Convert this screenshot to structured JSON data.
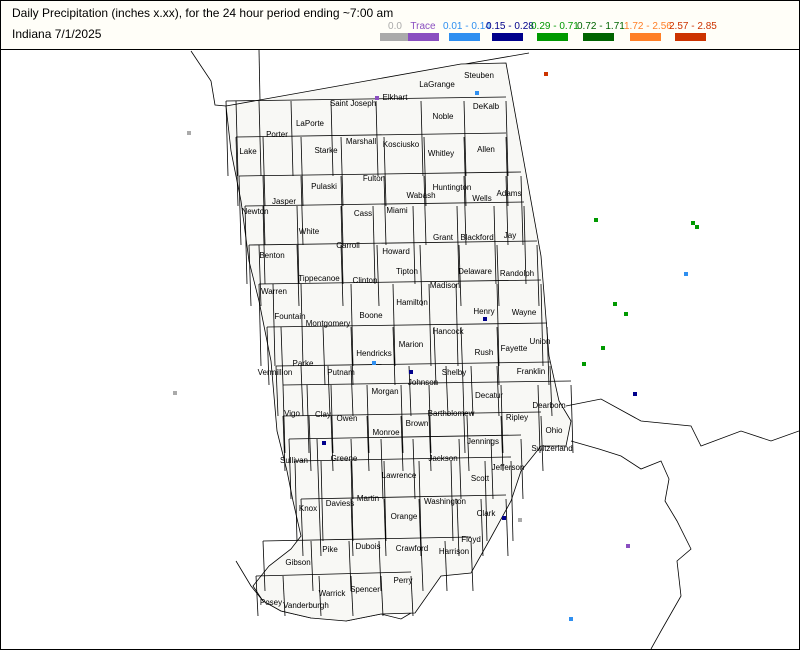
{
  "header": {
    "title": "Daily Precipitation (inches  x.xx),  for the 24 hour period ending ~7:00 am",
    "subtitle": "Indiana 7/1/2025"
  },
  "legend": [
    {
      "label": "0.0",
      "color": "#aaaaaa"
    },
    {
      "label": "Trace",
      "color": "#8a4fc0"
    },
    {
      "label": "0.01 - 0.14",
      "color": "#2f8ff0"
    },
    {
      "label": "0.15 - 0.28",
      "color": "#00008b"
    },
    {
      "label": "0.29 - 0.71",
      "color": "#009900"
    },
    {
      "label": "0.72 - 1.71",
      "color": "#006400"
    },
    {
      "label": "1.72 - 2.56",
      "color": "#ff7f27"
    },
    {
      "label": "2.57 - 2.85",
      "color": "#cc3300"
    }
  ],
  "counties": [
    {
      "name": "Lake"
    },
    {
      "name": "Porter"
    },
    {
      "name": "LaPorte"
    },
    {
      "name": "Saint Joseph"
    },
    {
      "name": "Elkhart"
    },
    {
      "name": "LaGrange"
    },
    {
      "name": "Steuben"
    },
    {
      "name": "DeKalb"
    },
    {
      "name": "Noble"
    },
    {
      "name": "Kosciusko"
    },
    {
      "name": "Marshall"
    },
    {
      "name": "Starke"
    },
    {
      "name": "Whitley"
    },
    {
      "name": "Allen"
    },
    {
      "name": "Newton"
    },
    {
      "name": "Jasper"
    },
    {
      "name": "Pulaski"
    },
    {
      "name": "Fulton"
    },
    {
      "name": "Huntington"
    },
    {
      "name": "Wabash"
    },
    {
      "name": "Miami"
    },
    {
      "name": "Cass"
    },
    {
      "name": "Wells"
    },
    {
      "name": "Adams"
    },
    {
      "name": "White"
    },
    {
      "name": "Carroll"
    },
    {
      "name": "Howard"
    },
    {
      "name": "Grant"
    },
    {
      "name": "Blackford"
    },
    {
      "name": "Jay"
    },
    {
      "name": "Benton"
    },
    {
      "name": "Tippecanoe"
    },
    {
      "name": "Clinton"
    },
    {
      "name": "Tipton"
    },
    {
      "name": "Delaware"
    },
    {
      "name": "Randolph"
    },
    {
      "name": "Warren"
    },
    {
      "name": "Madison"
    },
    {
      "name": "Fountain"
    },
    {
      "name": "Montgomery"
    },
    {
      "name": "Boone"
    },
    {
      "name": "Hamilton"
    },
    {
      "name": "Henry"
    },
    {
      "name": "Wayne"
    },
    {
      "name": "Hancock"
    },
    {
      "name": "Marion"
    },
    {
      "name": "Union"
    },
    {
      "name": "Fayette"
    },
    {
      "name": "Rush"
    },
    {
      "name": "Hendricks"
    },
    {
      "name": "Parke"
    },
    {
      "name": "Vermillion"
    },
    {
      "name": "Putnam"
    },
    {
      "name": "Johnson"
    },
    {
      "name": "Shelby"
    },
    {
      "name": "Franklin"
    },
    {
      "name": "Morgan"
    },
    {
      "name": "Decatur"
    },
    {
      "name": "Vigo"
    },
    {
      "name": "Clay"
    },
    {
      "name": "Owen"
    },
    {
      "name": "Bartholomew"
    },
    {
      "name": "Dearborn"
    },
    {
      "name": "Ripley"
    },
    {
      "name": "Ohio"
    },
    {
      "name": "Brown"
    },
    {
      "name": "Monroe"
    },
    {
      "name": "Jennings"
    },
    {
      "name": "Switzerland"
    },
    {
      "name": "Sullivan"
    },
    {
      "name": "Greene"
    },
    {
      "name": "Jackson"
    },
    {
      "name": "Jefferson"
    },
    {
      "name": "Lawrence"
    },
    {
      "name": "Scott"
    },
    {
      "name": "Knox"
    },
    {
      "name": "Daviess"
    },
    {
      "name": "Martin"
    },
    {
      "name": "Washington"
    },
    {
      "name": "Orange"
    },
    {
      "name": "Clark"
    },
    {
      "name": "Floyd"
    },
    {
      "name": "Pike"
    },
    {
      "name": "Dubois"
    },
    {
      "name": "Crawford"
    },
    {
      "name": "Harrison"
    },
    {
      "name": "Gibson"
    },
    {
      "name": "Perry"
    },
    {
      "name": "Warrick"
    },
    {
      "name": "Spencer"
    },
    {
      "name": "Posey"
    },
    {
      "name": "Vanderburgh"
    }
  ],
  "stations": [
    {
      "category": "Trace"
    },
    {
      "category": "0.01 - 0.14"
    },
    {
      "category": "2.57 - 2.85"
    },
    {
      "category": "0.0"
    },
    {
      "category": "0.29 - 0.71"
    },
    {
      "category": "0.29 - 0.71"
    },
    {
      "category": "0.29 - 0.71"
    },
    {
      "category": "0.01 - 0.14"
    },
    {
      "category": "0.29 - 0.71"
    },
    {
      "category": "0.29 - 0.71"
    },
    {
      "category": "0.15 - 0.28"
    },
    {
      "category": "0.29 - 0.71"
    },
    {
      "category": "0.29 - 0.71"
    },
    {
      "category": "0.01 - 0.14"
    },
    {
      "category": "0.15 - 0.28"
    },
    {
      "category": "0.0"
    },
    {
      "category": "0.15 - 0.28"
    },
    {
      "category": "0.15 - 0.28"
    },
    {
      "category": "0.15 - 0.28"
    },
    {
      "category": "0.0"
    },
    {
      "category": "Trace"
    },
    {
      "category": "0.01 - 0.14"
    }
  ]
}
